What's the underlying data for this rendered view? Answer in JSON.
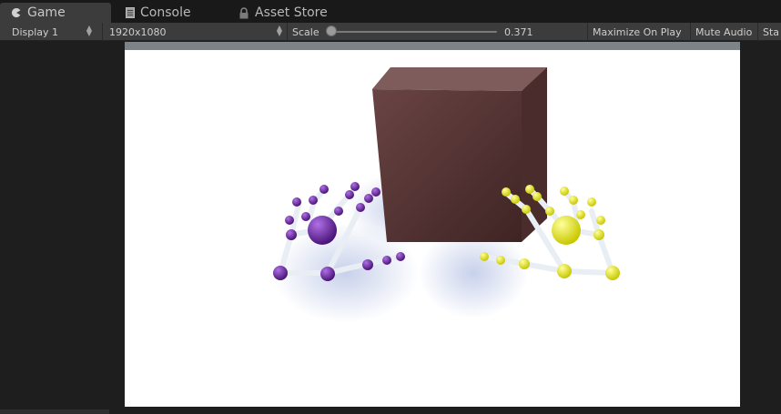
{
  "tabs": [
    {
      "label": "Game",
      "icon": "pacman-icon",
      "active": true
    },
    {
      "label": "Console",
      "icon": "console-icon",
      "active": false
    },
    {
      "label": "Asset Store",
      "icon": "lock-icon",
      "active": false
    }
  ],
  "toolbar": {
    "display_select": "Display 1",
    "resolution_select": "1920x1080",
    "scale_label": "Scale",
    "scale_value": "0.371",
    "scale_level": 0.371,
    "maximize_on_play": "Maximize On Play",
    "mute_audio": "Mute Audio",
    "stats_truncated": "Sta"
  },
  "colors": {
    "background": "#1e1e1e",
    "tab_active": "#3c3c3c",
    "cube": "#5a3838",
    "left_hand_joints": "#6a2aa0",
    "right_hand_joints": "#f2f21a",
    "bones": "#e8eef4"
  }
}
